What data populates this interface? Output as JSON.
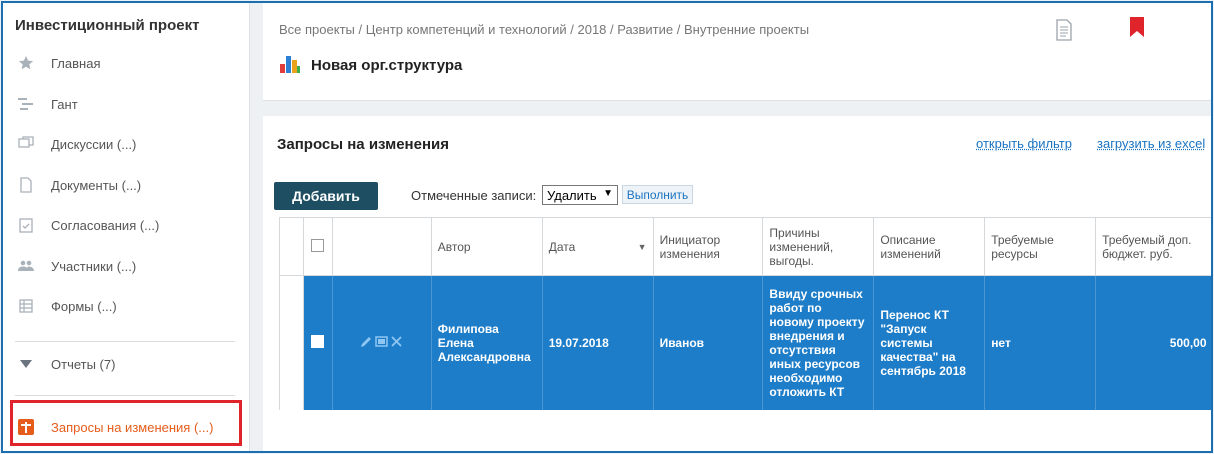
{
  "sidebar": {
    "title": "Инвестиционный проект",
    "items": [
      {
        "label": "Главная",
        "icon": "star-icon"
      },
      {
        "label": "Гант",
        "icon": "gantt-icon"
      },
      {
        "label": "Дискуссии (...)",
        "icon": "discussion-icon"
      },
      {
        "label": "Документы (...)",
        "icon": "document-icon"
      },
      {
        "label": "Согласования (...)",
        "icon": "approval-icon"
      },
      {
        "label": "Участники (...)",
        "icon": "users-icon"
      },
      {
        "label": "Формы (...)",
        "icon": "form-icon"
      }
    ],
    "reports": {
      "label": "Отчеты (7)",
      "icon": "triangle-down-icon"
    },
    "change_requests": {
      "label": "Запросы на изменения (...)",
      "icon": "plus-box-icon",
      "color": "#e65c1a"
    }
  },
  "header": {
    "breadcrumb": "Все проекты / Центр компетенций и технологий / 2018 / Развитие / Внутренние проекты",
    "title": "Новая орг.структура"
  },
  "main": {
    "section_title": "Запросы на изменения",
    "open_filter": "открыть фильтр",
    "load_excel": "загрузить из excel",
    "add_button": "Добавить",
    "marked_label": "Отмеченные записи:",
    "select_value": "Удалить",
    "execute_button": "Выполнить",
    "columns": [
      "Автор",
      "Дата",
      "Инициатор изменения",
      "Причины изменений, выгоды.",
      "Описание изменений",
      "Требуемые ресурсы",
      "Требуемый доп. бюджет. руб."
    ],
    "rows": [
      {
        "author": "Филипова Елена Александровна",
        "date": "19.07.2018",
        "initiator": "Иванов",
        "reason": "Ввиду срочных работ по новому проекту внедрения и отсутствия иных ресурсов необходимо отложить КТ",
        "description": "Перенос КТ \"Запуск системы качества\" на сентябрь 2018",
        "resources": "нет",
        "budget": "500,00"
      }
    ]
  },
  "colors": {
    "accent": "#1e7dc8",
    "dark_button": "#1d4e62",
    "highlight": "#e0242c",
    "active": "#e65c1a"
  }
}
